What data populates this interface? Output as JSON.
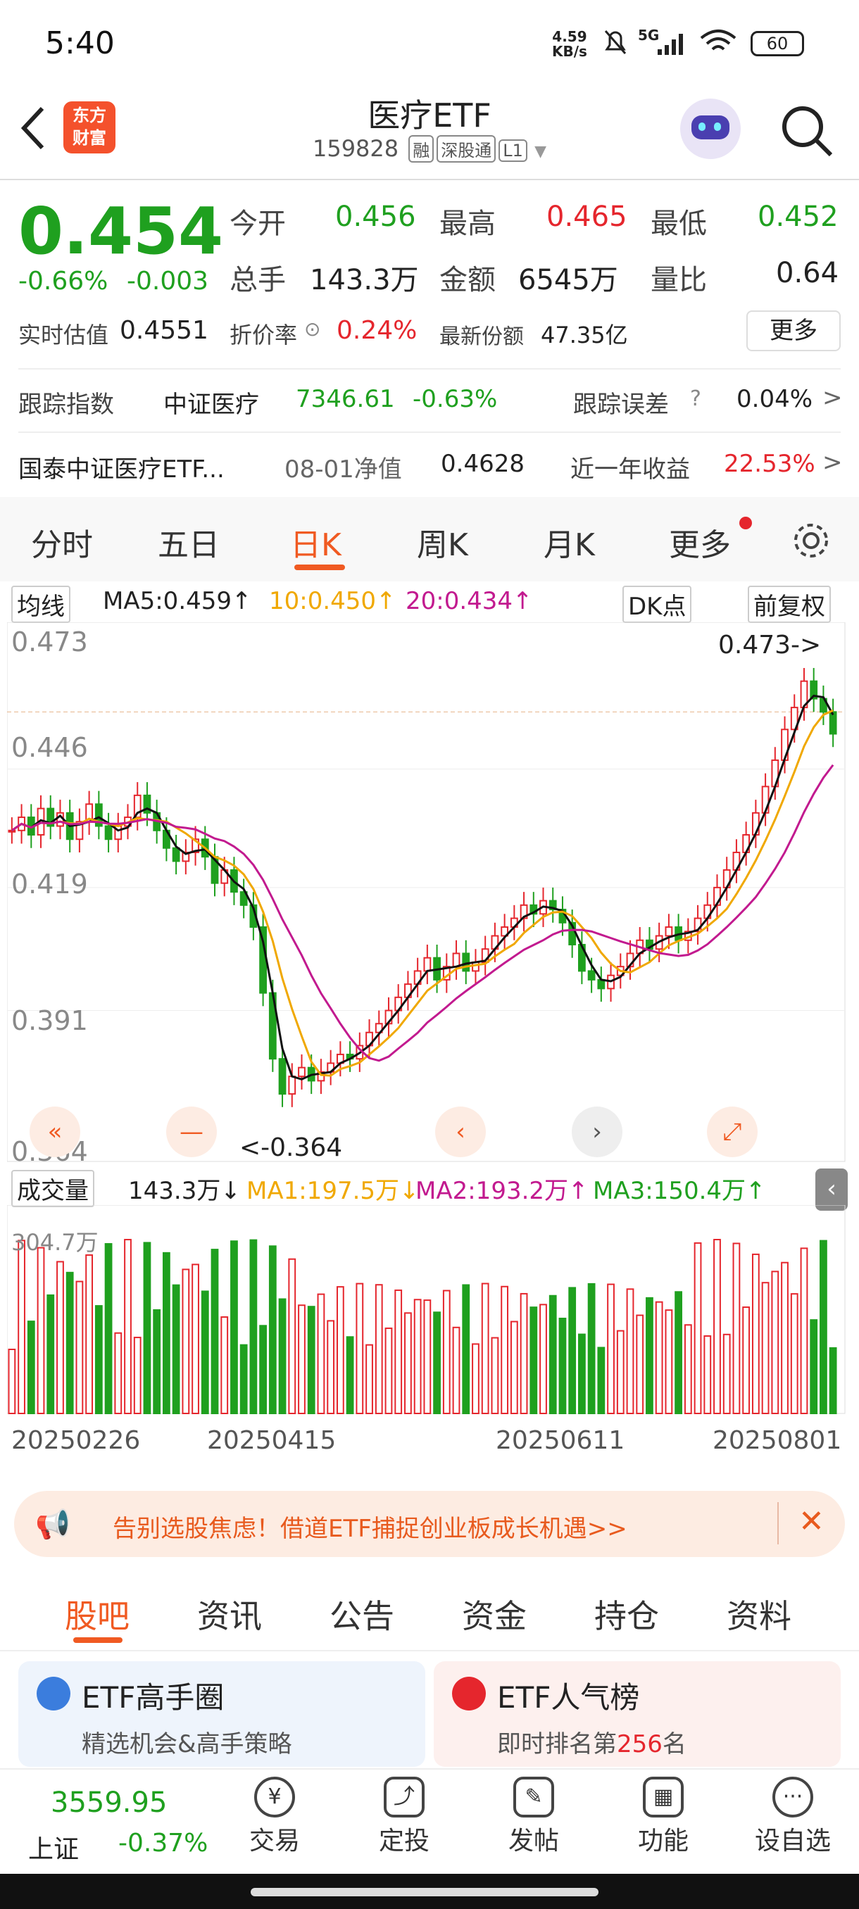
{
  "status": {
    "time": "5:40",
    "net_speed": "4.59\nKB/s",
    "battery": "60"
  },
  "header": {
    "app_logo": "东方\n财富",
    "title": "医疗ETF",
    "code": "159828",
    "tags": [
      "融",
      "深股通",
      "L1"
    ]
  },
  "quote": {
    "price": "0.454",
    "change_pct": "-0.66%",
    "change": "-0.003",
    "open_label": "今开",
    "open": "0.456",
    "high_label": "最高",
    "high": "0.465",
    "low_label": "最低",
    "low": "0.452",
    "vol_label": "总手",
    "vol": "143.3万",
    "amt_label": "金额",
    "amt": "6545万",
    "ratio_label": "量比",
    "ratio": "0.64",
    "est_label": "实时估值",
    "est": "0.4551",
    "disc_label": "折价率",
    "disc": "0.24%",
    "share_label": "最新份额",
    "share": "47.35亿",
    "more": "更多"
  },
  "tracking": {
    "index_label": "跟踪指数",
    "index_name": "中证医疗",
    "index_value": "7346.61",
    "index_pct": "-0.63%",
    "err_label": "跟踪误差",
    "err_value": "0.04%",
    "fund_name": "国泰中证医疗ETF...",
    "nav_label": "08-01净值",
    "nav": "0.4628",
    "ret_label": "近一年收益",
    "ret": "22.53%"
  },
  "chart_tabs": [
    "分时",
    "五日",
    "日K",
    "周K",
    "月K",
    "更多"
  ],
  "ma_bar": {
    "type": "均线",
    "ma5": "MA5:0.459↑",
    "ma10": "10:0.450↑",
    "ma20": "20:0.434↑",
    "dk": "DK点",
    "adj": "前复权"
  },
  "vol_bar": {
    "type": "成交量",
    "vol": "143.3万↓",
    "ma1": "MA1:197.5万↓",
    "ma2": "MA2:193.2万↑",
    "ma3": "MA3:150.4万↑"
  },
  "chart_data": {
    "type": "candlestick",
    "ylim": [
      0.364,
      0.473
    ],
    "yticks": [
      "0.473",
      "0.446",
      "0.419",
      "0.391",
      "0.364"
    ],
    "high_marker": "0.473->",
    "low_marker": "<-0.364",
    "x_labels": [
      "20250226",
      "20250415",
      "20250611",
      "20250801"
    ],
    "vol_max_label": "304.7万",
    "close": [
      0.432,
      0.435,
      0.431,
      0.437,
      0.433,
      0.436,
      0.43,
      0.434,
      0.438,
      0.433,
      0.43,
      0.433,
      0.435,
      0.44,
      0.436,
      0.432,
      0.428,
      0.425,
      0.427,
      0.43,
      0.426,
      0.42,
      0.423,
      0.418,
      0.415,
      0.41,
      0.395,
      0.38,
      0.372,
      0.376,
      0.378,
      0.375,
      0.377,
      0.379,
      0.381,
      0.38,
      0.383,
      0.386,
      0.388,
      0.391,
      0.394,
      0.397,
      0.4,
      0.403,
      0.398,
      0.401,
      0.404,
      0.4,
      0.402,
      0.405,
      0.408,
      0.41,
      0.412,
      0.415,
      0.413,
      0.416,
      0.414,
      0.411,
      0.406,
      0.4,
      0.398,
      0.396,
      0.399,
      0.401,
      0.404,
      0.407,
      0.405,
      0.408,
      0.41,
      0.407,
      0.409,
      0.412,
      0.415,
      0.419,
      0.423,
      0.427,
      0.431,
      0.436,
      0.442,
      0.448,
      0.455,
      0.46,
      0.466,
      0.462,
      0.459,
      0.454
    ]
  },
  "banner": {
    "text": "告别选股焦虑！借道ETF捕捉创业板成长机遇>>"
  },
  "bottom_tabs": [
    "股吧",
    "资讯",
    "公告",
    "资金",
    "持仓",
    "资料"
  ],
  "cards": [
    {
      "title": "ETF高手圈",
      "sub": "精选机会&高手策略"
    },
    {
      "title": "ETF人气榜",
      "sub_prefix": "即时排名第",
      "rank": "256",
      "sub_suffix": "名"
    }
  ],
  "nav": {
    "index_value": "3559.95",
    "index_name": "上证",
    "index_pct": "-0.37%",
    "items": [
      "交易",
      "定投",
      "发帖",
      "功能",
      "设自选"
    ]
  }
}
